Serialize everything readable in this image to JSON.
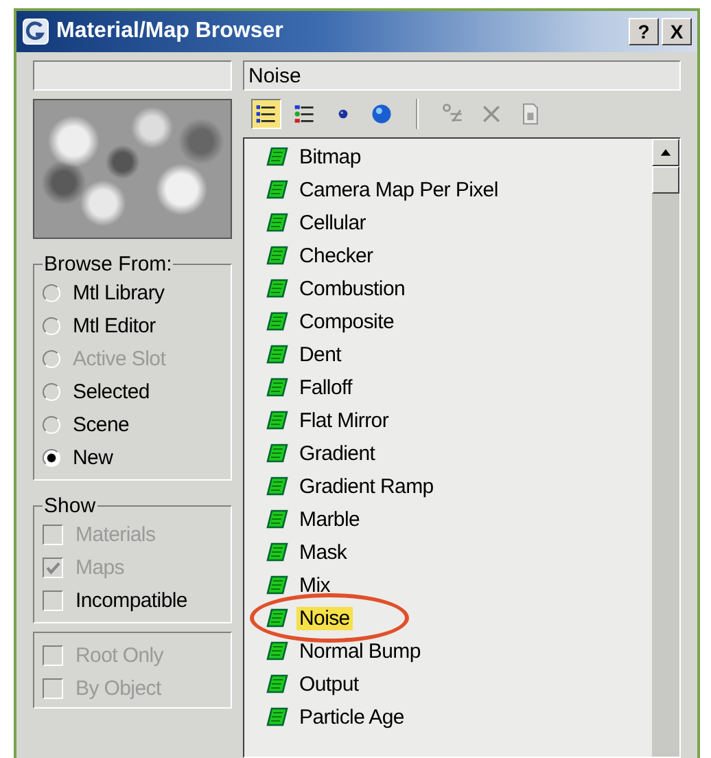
{
  "window": {
    "title": "Material/Map Browser",
    "buttons": [
      "?",
      "X"
    ]
  },
  "type_field": {
    "value": "Noise"
  },
  "view_buttons": [
    {
      "kind": "list",
      "selected": true
    },
    {
      "kind": "list-icons",
      "selected": false
    },
    {
      "kind": "small-icons",
      "selected": false
    },
    {
      "kind": "large-icons",
      "selected": false
    }
  ],
  "tool_buttons": [
    {
      "kind": "update",
      "disabled": true
    },
    {
      "kind": "delete",
      "disabled": true
    },
    {
      "kind": "clear",
      "disabled": true
    }
  ],
  "browse_from": {
    "title": "Browse From:",
    "options": [
      {
        "label": "Mtl Library",
        "selected": false,
        "disabled": false
      },
      {
        "label": "Mtl Editor",
        "selected": false,
        "disabled": false
      },
      {
        "label": "Active Slot",
        "selected": false,
        "disabled": true
      },
      {
        "label": "Selected",
        "selected": false,
        "disabled": false
      },
      {
        "label": "Scene",
        "selected": false,
        "disabled": false
      },
      {
        "label": "New",
        "selected": true,
        "disabled": false
      }
    ]
  },
  "show": {
    "title": "Show",
    "options": [
      {
        "label": "Materials",
        "checked": false,
        "disabled": true
      },
      {
        "label": "Maps",
        "checked": true,
        "disabled": true
      },
      {
        "label": "Incompatible",
        "checked": false,
        "disabled": false
      }
    ]
  },
  "options": [
    {
      "label": "Root Only",
      "checked": false,
      "disabled": true
    },
    {
      "label": "By Object",
      "checked": false,
      "disabled": true
    }
  ],
  "maps": [
    {
      "label": "Bitmap",
      "selected": false,
      "circled": false
    },
    {
      "label": "Camera Map Per Pixel",
      "selected": false,
      "circled": false
    },
    {
      "label": "Cellular",
      "selected": false,
      "circled": false
    },
    {
      "label": "Checker",
      "selected": false,
      "circled": false
    },
    {
      "label": "Combustion",
      "selected": false,
      "circled": false
    },
    {
      "label": "Composite",
      "selected": false,
      "circled": false
    },
    {
      "label": "Dent",
      "selected": false,
      "circled": false
    },
    {
      "label": "Falloff",
      "selected": false,
      "circled": false
    },
    {
      "label": "Flat Mirror",
      "selected": false,
      "circled": false
    },
    {
      "label": "Gradient",
      "selected": false,
      "circled": false
    },
    {
      "label": "Gradient Ramp",
      "selected": false,
      "circled": false
    },
    {
      "label": "Marble",
      "selected": false,
      "circled": false
    },
    {
      "label": "Mask",
      "selected": false,
      "circled": false
    },
    {
      "label": "Mix",
      "selected": false,
      "circled": false
    },
    {
      "label": "Noise",
      "selected": true,
      "circled": true
    },
    {
      "label": "Normal Bump",
      "selected": false,
      "circled": false
    },
    {
      "label": "Output",
      "selected": false,
      "circled": false
    },
    {
      "label": "Particle Age",
      "selected": false,
      "circled": false
    }
  ]
}
